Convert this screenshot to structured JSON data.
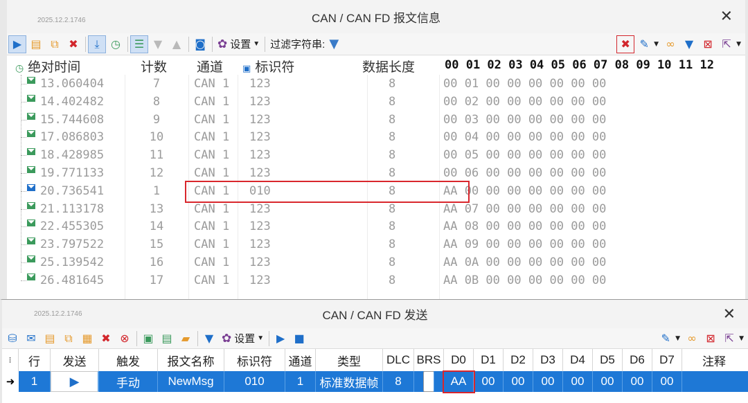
{
  "trace": {
    "build": "2025.12.2.1746",
    "title": "CAN / CAN FD 报文信息",
    "toolbar": {
      "settings_label": "设置",
      "filter_label": "过滤字符串:"
    },
    "columns": {
      "time": "绝对时间",
      "count": "计数",
      "channel": "通道",
      "id": "标识符",
      "dlc": "数据长度",
      "bytes": [
        "00",
        "01",
        "02",
        "03",
        "04",
        "05",
        "06",
        "07",
        "08",
        "09",
        "10",
        "11",
        "12"
      ]
    },
    "rows": [
      {
        "time": "13.060404",
        "count": "7",
        "channel": "CAN 1",
        "id": "123",
        "dlc": "8",
        "data": "00 01 00 00 00 00 00 00"
      },
      {
        "time": "14.402482",
        "count": "8",
        "channel": "CAN 1",
        "id": "123",
        "dlc": "8",
        "data": "00 02 00 00 00 00 00 00"
      },
      {
        "time": "15.744608",
        "count": "9",
        "channel": "CAN 1",
        "id": "123",
        "dlc": "8",
        "data": "00 03 00 00 00 00 00 00"
      },
      {
        "time": "17.086803",
        "count": "10",
        "channel": "CAN 1",
        "id": "123",
        "dlc": "8",
        "data": "00 04 00 00 00 00 00 00"
      },
      {
        "time": "18.428985",
        "count": "11",
        "channel": "CAN 1",
        "id": "123",
        "dlc": "8",
        "data": "00 05 00 00 00 00 00 00"
      },
      {
        "time": "19.771133",
        "count": "12",
        "channel": "CAN 1",
        "id": "123",
        "dlc": "8",
        "data": "00 06 00 00 00 00 00 00"
      },
      {
        "time": "20.736541",
        "count": "1",
        "channel": "CAN 1",
        "id": "010",
        "dlc": "8",
        "data": "AA 00 00 00 00 00 00 00",
        "selected": true
      },
      {
        "time": "21.113178",
        "count": "13",
        "channel": "CAN 1",
        "id": "123",
        "dlc": "8",
        "data": "AA 07 00 00 00 00 00 00"
      },
      {
        "time": "22.455305",
        "count": "14",
        "channel": "CAN 1",
        "id": "123",
        "dlc": "8",
        "data": "AA 08 00 00 00 00 00 00"
      },
      {
        "time": "23.797522",
        "count": "15",
        "channel": "CAN 1",
        "id": "123",
        "dlc": "8",
        "data": "AA 09 00 00 00 00 00 00"
      },
      {
        "time": "25.139542",
        "count": "16",
        "channel": "CAN 1",
        "id": "123",
        "dlc": "8",
        "data": "AA 0A 00 00 00 00 00 00"
      },
      {
        "time": "26.481645",
        "count": "17",
        "channel": "CAN 1",
        "id": "123",
        "dlc": "8",
        "data": "AA 0B 00 00 00 00 00 00"
      }
    ]
  },
  "tx": {
    "build": "2025.12.2.1746",
    "title": "CAN / CAN FD 发送",
    "toolbar": {
      "settings_label": "设置"
    },
    "columns": {
      "row": "行",
      "send": "发送",
      "trigger": "触发",
      "name": "报文名称",
      "id": "标识符",
      "channel": "通道",
      "type": "类型",
      "dlc": "DLC",
      "brs": "BRS",
      "d0": "D0",
      "d1": "D1",
      "d2": "D2",
      "d3": "D3",
      "d4": "D4",
      "d5": "D5",
      "d6": "D6",
      "d7": "D7",
      "comment": "注释"
    },
    "row": {
      "row": "1",
      "trigger": "手动",
      "name": "NewMsg",
      "id": "010",
      "channel": "1",
      "type": "标准数据帧",
      "dlc": "8",
      "d0": "AA",
      "d1": "00",
      "d2": "00",
      "d3": "00",
      "d4": "00",
      "d5": "00",
      "d6": "00",
      "d7": "00",
      "comment": ""
    }
  },
  "colors": {
    "accent": "#1e78d6",
    "highlight": "#d9262c",
    "message_icon": "#3b9a5c"
  }
}
